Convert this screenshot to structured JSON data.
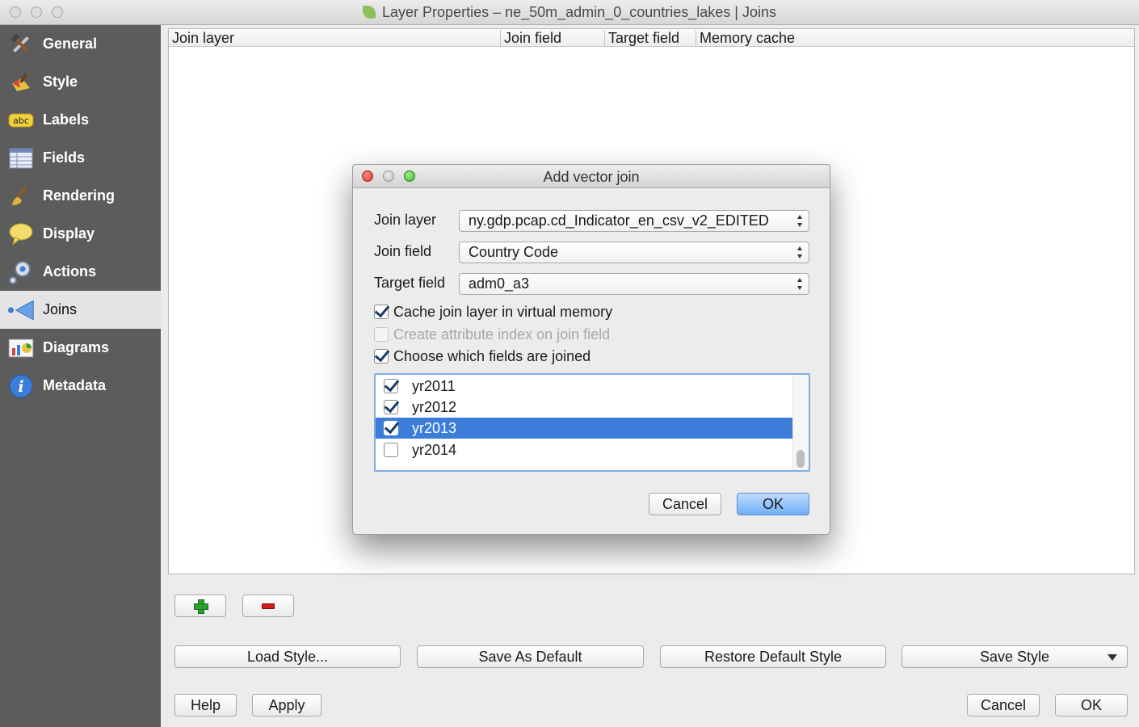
{
  "window": {
    "title": "Layer Properties – ne_50m_admin_0_countries_lakes | Joins"
  },
  "sidebar": {
    "items": [
      {
        "label": "General",
        "icon": "hammer-wrench-icon"
      },
      {
        "label": "Style",
        "icon": "paintbrush-icon"
      },
      {
        "label": "Labels",
        "icon": "abc-label-icon"
      },
      {
        "label": "Fields",
        "icon": "table-icon"
      },
      {
        "label": "Rendering",
        "icon": "brush-icon"
      },
      {
        "label": "Display",
        "icon": "speech-bubble-icon"
      },
      {
        "label": "Actions",
        "icon": "gear-actions-icon"
      },
      {
        "label": "Joins",
        "icon": "join-arrow-icon",
        "active": true
      },
      {
        "label": "Diagrams",
        "icon": "diagram-chart-icon"
      },
      {
        "label": "Metadata",
        "icon": "info-icon"
      }
    ]
  },
  "joins_table": {
    "columns": [
      "Join layer",
      "Join field",
      "Target field",
      "Memory cache"
    ]
  },
  "buttons": {
    "load_style": "Load Style...",
    "save_as_default": "Save As Default",
    "restore_default_style": "Restore Default Style",
    "save_style": "Save Style",
    "help": "Help",
    "apply": "Apply",
    "cancel": "Cancel",
    "ok": "OK"
  },
  "dialog": {
    "title": "Add vector join",
    "join_layer_label": "Join layer",
    "join_layer_value": "ny.gdp.pcap.cd_Indicator_en_csv_v2_EDITED",
    "join_field_label": "Join field",
    "join_field_value": "Country Code",
    "target_field_label": "Target field",
    "target_field_value": "adm0_a3",
    "cache_checkbox": {
      "label": "Cache join layer in virtual memory",
      "checked": true,
      "enabled": true
    },
    "index_checkbox": {
      "label": "Create attribute index on join field",
      "checked": false,
      "enabled": false
    },
    "choose_fields_checkbox": {
      "label": "Choose which fields are joined",
      "checked": true,
      "enabled": true
    },
    "fields": [
      {
        "name": "yr2011",
        "checked": true,
        "selected": false
      },
      {
        "name": "yr2012",
        "checked": true,
        "selected": false
      },
      {
        "name": "yr2013",
        "checked": true,
        "selected": true
      },
      {
        "name": "yr2014",
        "checked": false,
        "selected": false
      }
    ],
    "cancel": "Cancel",
    "ok": "OK"
  },
  "colors": {
    "sidebar_bg": "#5c5c5c",
    "selection": "#3b7dd8",
    "default_button": "#6fb0f5"
  }
}
